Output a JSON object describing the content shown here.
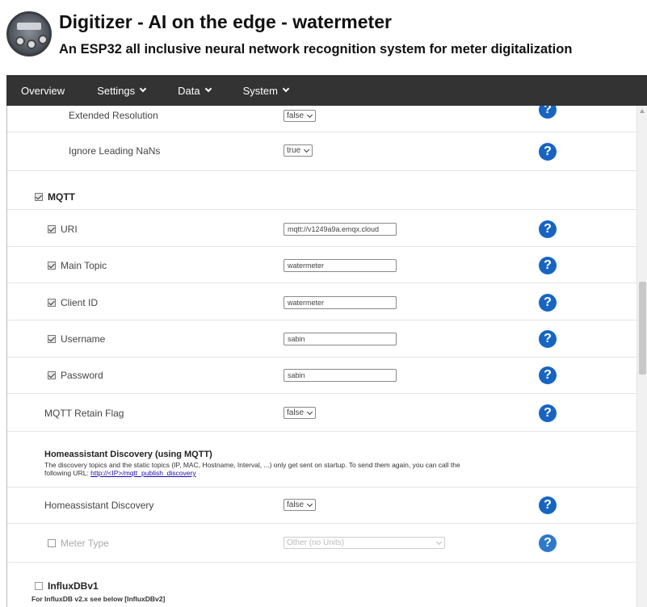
{
  "header": {
    "title": "Digitizer - AI on the edge - watermeter",
    "subtitle": "An ESP32 all inclusive neural network recognition system for meter digitalization"
  },
  "nav": {
    "items": [
      {
        "label": "Overview"
      },
      {
        "label": "Settings"
      },
      {
        "label": "Data"
      },
      {
        "label": "System"
      }
    ]
  },
  "settings": {
    "extended_resolution": {
      "label": "Extended Resolution",
      "value": "false"
    },
    "ignore_leading_nans": {
      "label": "Ignore Leading NaNs",
      "value": "true"
    },
    "mqtt": {
      "section": "MQTT",
      "uri": {
        "label": "URI",
        "value": "mqtt://v1249a9a.emqx.cloud"
      },
      "main_topic": {
        "label": "Main Topic",
        "value": "watermeter"
      },
      "client_id": {
        "label": "Client ID",
        "value": "watermeter"
      },
      "username": {
        "label": "Username",
        "value": "sabin"
      },
      "password": {
        "label": "Password",
        "value": "sabin"
      },
      "retain_flag": {
        "label": "MQTT Retain Flag",
        "value": "false"
      }
    },
    "homeassistant": {
      "heading": "Homeassistant Discovery (using MQTT)",
      "desc_line1": "The discovery topics and the static topics (IP, MAC, Hostname, Interval, ...) only get sent on startup. To send them again, you can call the",
      "desc_line2_prefix": "following URL: ",
      "desc_link": "http://<IP>/mqtt_publish_discovery",
      "discovery": {
        "label": "Homeassistant Discovery",
        "value": "false"
      },
      "meter_type": {
        "label": "Meter Type",
        "value": "Other (no Units)"
      }
    },
    "influxdb": {
      "section": "InfluxDBv1",
      "note": "For InfluxDB v2.x see below [InfluxDBv2]"
    }
  },
  "help_icon": "?",
  "colors": {
    "nav_bg": "#333333",
    "help_icon": "#1765c1",
    "link": "#1a0dab"
  }
}
